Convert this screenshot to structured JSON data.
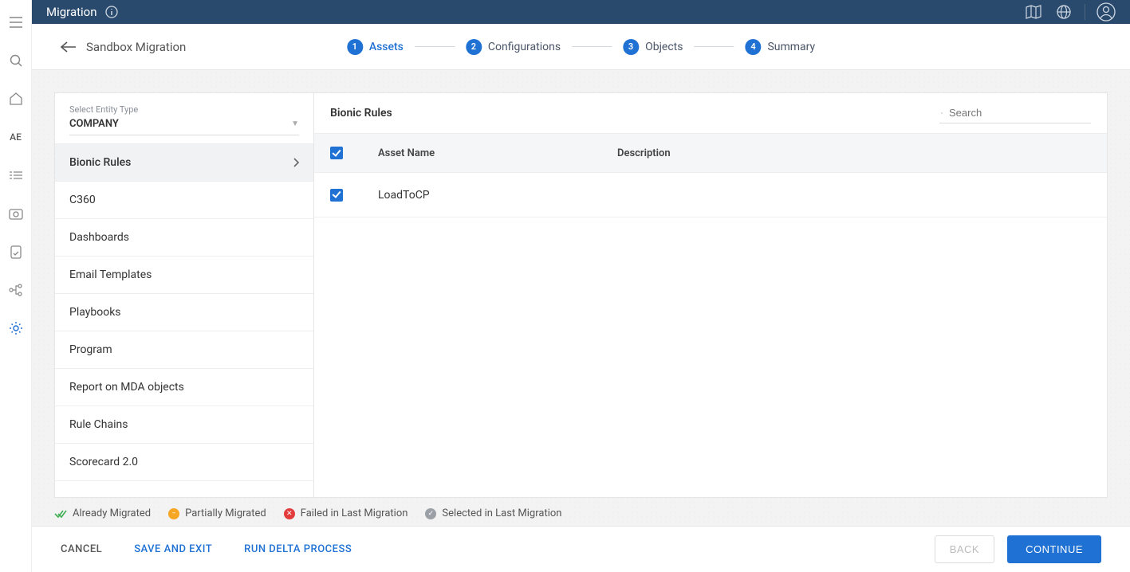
{
  "topbar": {
    "title": "Migration"
  },
  "subhead": {
    "back_label": "Sandbox Migration",
    "steps": [
      {
        "num": "1",
        "label": "Assets",
        "active": true
      },
      {
        "num": "2",
        "label": "Configurations",
        "active": false
      },
      {
        "num": "3",
        "label": "Objects",
        "active": false
      },
      {
        "num": "4",
        "label": "Summary",
        "active": false
      }
    ]
  },
  "entity": {
    "select_label": "Select Entity Type",
    "selected": "COMPANY"
  },
  "categories": [
    {
      "label": "Bionic Rules",
      "active": true
    },
    {
      "label": "C360",
      "active": false
    },
    {
      "label": "Dashboards",
      "active": false
    },
    {
      "label": "Email Templates",
      "active": false
    },
    {
      "label": "Playbooks",
      "active": false
    },
    {
      "label": "Program",
      "active": false
    },
    {
      "label": "Report on MDA objects",
      "active": false
    },
    {
      "label": "Rule Chains",
      "active": false
    },
    {
      "label": "Scorecard 2.0",
      "active": false
    }
  ],
  "assets": {
    "panel_title": "Bionic Rules",
    "search_placeholder": "Search",
    "columns": {
      "name": "Asset Name",
      "desc": "Description"
    },
    "rows": [
      {
        "name": "LoadToCP",
        "desc": ""
      }
    ]
  },
  "legend": {
    "already": "Already Migrated",
    "partial": "Partially Migrated",
    "failed": "Failed in Last Migration",
    "selected": "Selected in Last Migration"
  },
  "footer": {
    "cancel": "CANCEL",
    "save_exit": "SAVE AND EXIT",
    "run_delta": "RUN DELTA PROCESS",
    "back": "BACK",
    "continue": "CONTINUE"
  },
  "rail": {
    "ae": "AE"
  }
}
